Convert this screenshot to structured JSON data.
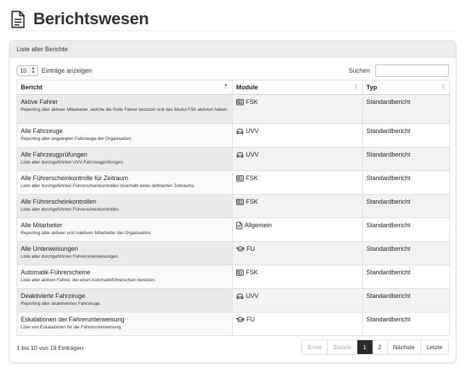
{
  "page": {
    "title": "Berichtswesen"
  },
  "card": {
    "title": "Liste aller Berichte"
  },
  "controls": {
    "length_value": "10",
    "length_suffix": "Einträge anzeigen",
    "search_label": "Suchen",
    "search_value": ""
  },
  "table": {
    "headers": {
      "report": "Bericht",
      "module": "Module",
      "type": "Typ"
    },
    "sorted_column": "report",
    "sort_direction": "ascending",
    "rows": [
      {
        "title": "Aktive Fahrer",
        "desc": "Reporting aller aktiven Mitarbeiter, welche die Rolle Fahrer besitzen und das Modul FSK aktiviert haben.",
        "module": "FSK",
        "module_icon": "license-card-icon",
        "type": "Standardbericht"
      },
      {
        "title": "Alle Fahrzeuge",
        "desc": "Reporting aller angelegten Fahrzeuge der Organisation.",
        "module": "UVV",
        "module_icon": "car-icon",
        "type": "Standardbericht"
      },
      {
        "title": "Alle Fahrzeugprüfungen",
        "desc": "Liste aller durchgeführten UVV-Fahrzeugprüfungen.",
        "module": "UVV",
        "module_icon": "car-icon",
        "type": "Standardbericht"
      },
      {
        "title": "Alle Führerscheinkontrolle für Zeitraum",
        "desc": "Liste aller durchgeführten Führerscheinkontrollen innerhalb eines definierten Zeitraums.",
        "module": "FSK",
        "module_icon": "license-card-icon",
        "type": "Standardbericht"
      },
      {
        "title": "Alle Führerscheinkontrollen",
        "desc": "Liste aller durchgeführten Führerscheinkontrollen.",
        "module": "FSK",
        "module_icon": "license-card-icon",
        "type": "Standardbericht"
      },
      {
        "title": "Alle Mitarbeiter",
        "desc": "Reporting aller aktiven und inaktiven Mitarbeiter der Organisation.",
        "module": "Allgemein",
        "module_icon": "document-icon",
        "type": "Standardbericht"
      },
      {
        "title": "Alle Unterweisungen",
        "desc": "Liste aller durchgeführten Fahrerunterweisungen.",
        "module": "FU",
        "module_icon": "graduation-cap-icon",
        "type": "Standardbericht"
      },
      {
        "title": "Automatik-Führerscheine",
        "desc": "Liste aller aktiven Fahrer, die einen Automatikführerschein besitzen.",
        "module": "FSK",
        "module_icon": "license-card-icon",
        "type": "Standardbericht"
      },
      {
        "title": "Deaktivierte Fahrzeuge",
        "desc": "Reporting aller deaktivierten Fahrzeuge.",
        "module": "UVV",
        "module_icon": "car-icon",
        "type": "Standardbericht"
      },
      {
        "title": "Eskalationen der Fahrerunterweisung",
        "desc": "Liste von Eskalationen für die Fahrerunterweisung.",
        "module": "FU",
        "module_icon": "graduation-cap-icon",
        "type": "Standardbericht"
      }
    ]
  },
  "footer": {
    "info": "1 bis 10 von 19 Einträgen",
    "pager": {
      "first": "Erste",
      "prev": "Zurück",
      "page1": "1",
      "page2": "2",
      "next": "Nächste",
      "last": "Letzte",
      "current_page": 1
    }
  },
  "colors": {
    "active_page_bg": "#2b2b2b",
    "header_bar_bg": "#ebebeb",
    "odd_row_bg": "#f2f2f2"
  }
}
